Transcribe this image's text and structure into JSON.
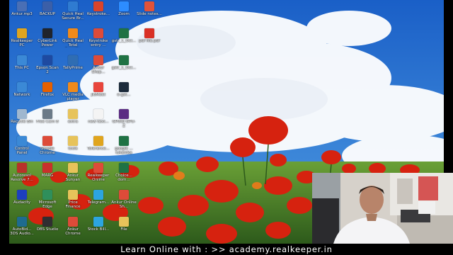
{
  "desktop": {
    "icons": [
      {
        "label": "Ankur.mp3",
        "icon": "audio-file-icon",
        "color": "#4a6fb5"
      },
      {
        "label": "BACKUP",
        "icon": "backup-shortcut-icon",
        "color": "#3b5fa8"
      },
      {
        "label": "Quick Heal Secure Br...",
        "icon": "quick-heal-browser-icon",
        "color": "#2f7bd1"
      },
      {
        "label": "Keystroke...",
        "icon": "keystroke-app-icon",
        "color": "#d9442b"
      },
      {
        "label": "Zoom",
        "icon": "zoom-icon",
        "color": "#2d8cff"
      },
      {
        "label": "Slide notes...",
        "icon": "slide-notes-icon",
        "color": "#e0533a"
      },
      {
        "label": "Realkeeper PC",
        "icon": "realkeeper-pc-icon",
        "color": "#e0a51e"
      },
      {
        "label": "CyberLink Power Direc...",
        "icon": "cyberlink-powerdirector-icon",
        "color": "#20242c"
      },
      {
        "label": "Quick Heal Total Security",
        "icon": "quick-heal-icon",
        "color": "#f08a1b"
      },
      {
        "label": "Keystroke entry ...",
        "icon": "chrome-icon",
        "color": "#dd4b39"
      },
      {
        "label": "gstr_1_Oct...",
        "icon": "excel-file-icon",
        "color": "#1f7244"
      },
      {
        "label": "pdf file.pdf",
        "icon": "pdf-file-icon",
        "color": "#d93025"
      },
      {
        "label": "This PC",
        "icon": "this-pc-icon",
        "color": "#3b89d6"
      },
      {
        "label": "Epson Scan 2",
        "icon": "epson-scan-icon",
        "color": "#1e4aa1"
      },
      {
        "label": "TallyPrime",
        "icon": "tallyprime-icon",
        "color": "#2f6db3"
      },
      {
        "label": "Ankur Shop...",
        "icon": "chrome-icon",
        "color": "#dd4b39"
      },
      {
        "label": "gstr_1_Oct...",
        "icon": "excel-file-icon",
        "color": "#1f7244"
      },
      {
        "label": "Network",
        "icon": "network-icon",
        "color": "#3b89d6"
      },
      {
        "label": "Firefox",
        "icon": "firefox-icon",
        "color": "#e66000"
      },
      {
        "label": "VLC media player",
        "icon": "vlc-icon",
        "color": "#f08a1b"
      },
      {
        "label": "JioMeet",
        "icon": "jiomeet-icon",
        "color": "#e8453c"
      },
      {
        "label": "e-gst...",
        "icon": "document-icon",
        "color": "#1b2a3a"
      },
      {
        "label": "Recycle Bin",
        "icon": "recycle-bin-icon",
        "color": "#9fb7cf"
      },
      {
        "label": "Free Cam 8",
        "icon": "free-cam-icon",
        "color": "#6b7a88"
      },
      {
        "label": "extra",
        "icon": "folder-icon",
        "color": "#e7c35a"
      },
      {
        "label": "new text...",
        "icon": "text-file-icon",
        "color": "#f4f4f4"
      },
      {
        "label": "GPUID GPU-Z",
        "icon": "gpu-z-icon",
        "color": "#5b2c83"
      },
      {
        "label": "Control Panel",
        "icon": "control-panel-icon",
        "color": "#3b89d6"
      },
      {
        "label": "Google Chrome",
        "icon": "chrome-icon",
        "color": "#dd4b39"
      },
      {
        "label": "tools",
        "icon": "folder-icon",
        "color": "#e7c35a"
      },
      {
        "label": "Tolerance...",
        "icon": "tolerance-icon",
        "color": "#e0a51e"
      },
      {
        "label": "google ... lukamka",
        "icon": "excel-file-icon",
        "color": "#1f7244"
      },
      {
        "label": "Autoresol Resolve 7...",
        "icon": "resolve-icon",
        "color": "#b8322a"
      },
      {
        "label": "MARG",
        "icon": "marg-icon",
        "color": "#c9302c"
      },
      {
        "label": "Ankur Sunyan Marketing",
        "icon": "folder-icon",
        "color": "#e7c35a"
      },
      {
        "label": "Realkeeper Online",
        "icon": "chrome-icon",
        "color": "#dd4b39"
      },
      {
        "label": "Choice... dom...",
        "icon": "excel-file-icon",
        "color": "#1f7244"
      },
      {
        "label": "Audacity",
        "icon": "audacity-icon",
        "color": "#1d3fbf"
      },
      {
        "label": "Microsoft Edge",
        "icon": "edge-icon",
        "color": "#2f8f5b"
      },
      {
        "label": "Price Finance",
        "icon": "folder-icon",
        "color": "#e7c35a"
      },
      {
        "label": "Telegram...",
        "icon": "telegram-icon",
        "color": "#2ca5e0"
      },
      {
        "label": "Ankur Online Sh...",
        "icon": "chrome-icon",
        "color": "#dd4b39"
      },
      {
        "label": "AutoBid... 3DS Audio...",
        "icon": "autodesk-icon",
        "color": "#1e6b8f"
      },
      {
        "label": "OBS Studio",
        "icon": "obs-studio-icon",
        "color": "#302e31"
      },
      {
        "label": "Ankur Chrome",
        "icon": "chrome-icon",
        "color": "#dd4b39"
      },
      {
        "label": "Stock Bill...",
        "icon": "telegram-icon",
        "color": "#2ca5e0"
      },
      {
        "label": "File",
        "icon": "folder-icon",
        "color": "#e7c35a"
      }
    ]
  },
  "banner": {
    "text": "Learn Online with : >> academy.realkeeper.in"
  }
}
